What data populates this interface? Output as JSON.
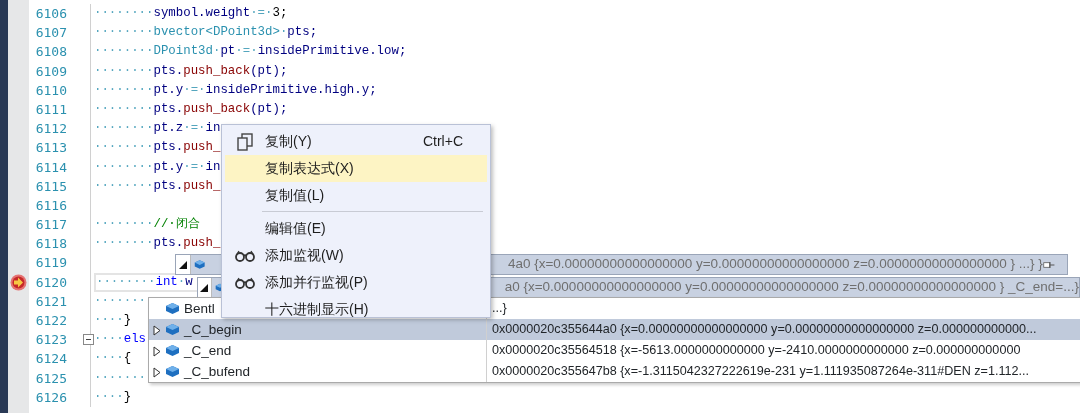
{
  "lines": [
    {
      "number": "6106",
      "breakpoint": false,
      "current": false,
      "foldable": false,
      "segments": [
        {
          "text": "········",
          "kind": "ws"
        },
        {
          "text": "symbol.weight",
          "kind": "ident"
        },
        {
          "text": "·=·",
          "kind": "ws"
        },
        {
          "text": "3;",
          "kind": "punct"
        }
      ]
    },
    {
      "number": "6107",
      "breakpoint": false,
      "current": false,
      "foldable": false,
      "segments": [
        {
          "text": "········",
          "kind": "ws"
        },
        {
          "text": "bvector<DPoint3d>",
          "kind": "type"
        },
        {
          "text": "·",
          "kind": "ws"
        },
        {
          "text": "pts;",
          "kind": "ident"
        }
      ]
    },
    {
      "number": "6108",
      "breakpoint": false,
      "current": false,
      "foldable": false,
      "segments": [
        {
          "text": "········",
          "kind": "ws"
        },
        {
          "text": "DPoint3d",
          "kind": "type"
        },
        {
          "text": "·",
          "kind": "ws"
        },
        {
          "text": "pt",
          "kind": "ident"
        },
        {
          "text": "·=·",
          "kind": "ws"
        },
        {
          "text": "insidePrimitive.low;",
          "kind": "ident"
        }
      ]
    },
    {
      "number": "6109",
      "breakpoint": false,
      "current": false,
      "foldable": false,
      "segments": [
        {
          "text": "········",
          "kind": "ws"
        },
        {
          "text": "pts.",
          "kind": "ident"
        },
        {
          "text": "push_back",
          "kind": "func"
        },
        {
          "text": "(pt);",
          "kind": "ident"
        }
      ]
    },
    {
      "number": "6110",
      "breakpoint": false,
      "current": false,
      "foldable": false,
      "segments": [
        {
          "text": "········",
          "kind": "ws"
        },
        {
          "text": "pt.y",
          "kind": "ident"
        },
        {
          "text": "·=·",
          "kind": "ws"
        },
        {
          "text": "insidePrimitive.high.y;",
          "kind": "ident"
        }
      ]
    },
    {
      "number": "6111",
      "breakpoint": false,
      "current": false,
      "foldable": false,
      "segments": [
        {
          "text": "········",
          "kind": "ws"
        },
        {
          "text": "pts.",
          "kind": "ident"
        },
        {
          "text": "push_back",
          "kind": "func"
        },
        {
          "text": "(pt);",
          "kind": "ident"
        }
      ]
    },
    {
      "number": "6112",
      "breakpoint": false,
      "current": false,
      "foldable": false,
      "segments": [
        {
          "text": "········",
          "kind": "ws"
        },
        {
          "text": "pt.z",
          "kind": "ident"
        },
        {
          "text": "·=·",
          "kind": "ws"
        },
        {
          "text": "in",
          "kind": "ident"
        }
      ]
    },
    {
      "number": "6113",
      "breakpoint": false,
      "current": false,
      "foldable": false,
      "segments": [
        {
          "text": "········",
          "kind": "ws"
        },
        {
          "text": "pts.",
          "kind": "ident"
        },
        {
          "text": "push_",
          "kind": "func"
        }
      ]
    },
    {
      "number": "6114",
      "breakpoint": false,
      "current": false,
      "foldable": false,
      "segments": [
        {
          "text": "········",
          "kind": "ws"
        },
        {
          "text": "pt.y",
          "kind": "ident"
        },
        {
          "text": "·=·",
          "kind": "ws"
        },
        {
          "text": "in",
          "kind": "ident"
        }
      ]
    },
    {
      "number": "6115",
      "breakpoint": false,
      "current": false,
      "foldable": false,
      "segments": [
        {
          "text": "········",
          "kind": "ws"
        },
        {
          "text": "pts.",
          "kind": "ident"
        },
        {
          "text": "push_",
          "kind": "func"
        }
      ]
    },
    {
      "number": "6116",
      "breakpoint": false,
      "current": false,
      "foldable": false
    },
    {
      "number": "6117",
      "breakpoint": false,
      "current": false,
      "foldable": false,
      "segments": [
        {
          "text": "········",
          "kind": "ws"
        },
        {
          "text": "//·闭合",
          "kind": "comment"
        }
      ]
    },
    {
      "number": "6118",
      "breakpoint": false,
      "current": false,
      "foldable": false,
      "segments": [
        {
          "text": "········",
          "kind": "ws"
        },
        {
          "text": "pts.",
          "kind": "ident"
        },
        {
          "text": "push_",
          "kind": "func"
        }
      ]
    },
    {
      "number": "6119",
      "breakpoint": false,
      "current": false,
      "foldable": false
    },
    {
      "number": "6120",
      "breakpoint": true,
      "current": true,
      "foldable": false,
      "segments": [
        {
          "text": "········",
          "kind": "ws"
        },
        {
          "text": "int",
          "kind": "keyword"
        },
        {
          "text": "·",
          "kind": "ws"
        },
        {
          "text": "w",
          "kind": "ident"
        }
      ]
    },
    {
      "number": "6121",
      "breakpoint": false,
      "current": false,
      "foldable": false,
      "segments": [
        {
          "text": "·······",
          "kind": "ws"
        }
      ]
    },
    {
      "number": "6122",
      "breakpoint": false,
      "current": false,
      "foldable": false,
      "segments": [
        {
          "text": "····",
          "kind": "ws"
        },
        {
          "text": "}",
          "kind": "punct"
        }
      ]
    },
    {
      "number": "6123",
      "breakpoint": false,
      "current": false,
      "foldable": true,
      "segments": [
        {
          "text": "····",
          "kind": "ws"
        },
        {
          "text": "els",
          "kind": "keyword"
        }
      ]
    },
    {
      "number": "6124",
      "breakpoint": false,
      "current": false,
      "foldable": false,
      "segments": [
        {
          "text": "····",
          "kind": "ws"
        },
        {
          "text": "{",
          "kind": "punct"
        }
      ]
    },
    {
      "number": "6125",
      "breakpoint": false,
      "current": false,
      "foldable": false,
      "segments": [
        {
          "text": "·······",
          "kind": "ws"
        }
      ]
    },
    {
      "number": "6126",
      "breakpoint": false,
      "current": false,
      "foldable": false,
      "segments": [
        {
          "text": "····",
          "kind": "ws"
        },
        {
          "text": "}",
          "kind": "punct"
        }
      ]
    }
  ],
  "datatips": [
    {
      "value": "4a0 {x=0.00000000000000000 y=0.00000000000000000 z=0.00000000000000000 } ...} }",
      "pin": true
    },
    {
      "value": "a0 {x=0.00000000000000000 y=0.00000000000000000 z=0.00000000000000000 } _C_end=...}",
      "pin": false
    }
  ],
  "members": [
    {
      "name": "Bentl",
      "value": "...}",
      "expandable": false,
      "selected": false
    },
    {
      "name": "_C_begin",
      "value": "0x0000020c355644a0 {x=0.00000000000000000 y=0.00000000000000000 z=0.000000000000...",
      "expandable": true,
      "selected": true
    },
    {
      "name": "_C_end",
      "value": "0x0000020c35564518 {x=-5613.0000000000000 y=-2410.0000000000000 z=0.000000000000",
      "expandable": true,
      "selected": false
    },
    {
      "name": "_C_bufend",
      "value": "0x0000020c355647b8 {x=-1.3115042327222619e-231 y=1.111935087264e-311#DEN z=1.112...",
      "expandable": true,
      "selected": false
    }
  ],
  "context_menu": [
    {
      "label": "复制(Y)",
      "shortcut": "Ctrl+C",
      "kind": "copy",
      "selected": false,
      "separator_before": false
    },
    {
      "label": "复制表达式(X)",
      "selected": true,
      "separator_before": false
    },
    {
      "label": "复制值(L)",
      "selected": false,
      "separator_before": false
    },
    {
      "label": "编辑值(E)",
      "selected": false,
      "separator_before": true
    },
    {
      "label": "添加监视(W)",
      "kind": "watch",
      "selected": false,
      "separator_before": false
    },
    {
      "label": "添加并行监视(P)",
      "kind": "watch",
      "selected": false,
      "separator_before": false
    },
    {
      "label": "十六进制显示(H)",
      "selected": false,
      "separator_before": false
    }
  ]
}
